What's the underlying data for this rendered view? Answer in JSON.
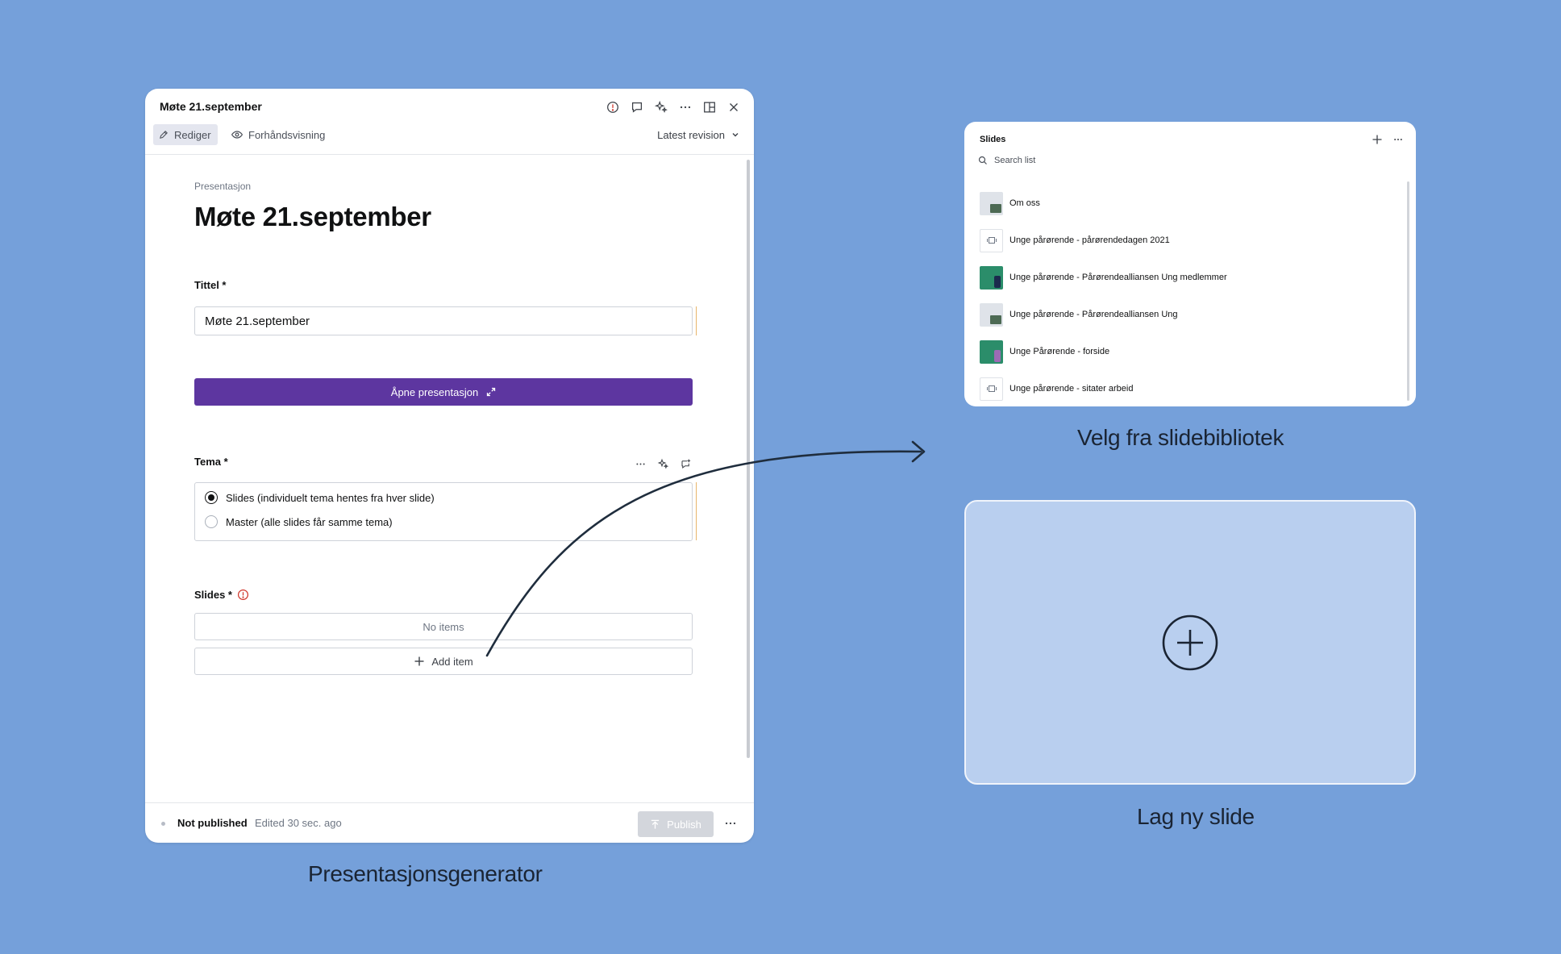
{
  "editor": {
    "window_title": "Møte 21.september",
    "tabs": {
      "edit": "Rediger",
      "preview": "Forhåndsvisning"
    },
    "revision": "Latest revision",
    "document_type": "Presentasjon",
    "document_title": "Møte 21.september",
    "fields": {
      "tittel": {
        "label": "Tittel *",
        "value": "Møte 21.september"
      },
      "open_button": "Åpne presentasjon",
      "tema": {
        "label": "Tema *",
        "options": [
          {
            "label": "Slides (individuelt tema hentes fra hver slide)",
            "selected": true
          },
          {
            "label": "Master (alle slides får samme tema)",
            "selected": false
          }
        ]
      },
      "slides": {
        "label": "Slides *",
        "empty_text": "No items",
        "add_label": "Add item"
      }
    },
    "footer": {
      "status": "Not published",
      "edited": "Edited 30 sec. ago",
      "publish_label": "Publish"
    },
    "colors": {
      "primary_button": "#5d36a0",
      "accent_bar": "#e8b56b",
      "warning": "#d0352a"
    }
  },
  "library": {
    "title": "Slides",
    "search_placeholder": "Search list",
    "items": [
      {
        "label": "Om oss",
        "thumb": "light-photo"
      },
      {
        "label": "Unge pårørende - pårørendedagen 2021",
        "thumb": "slide-icon"
      },
      {
        "label": "Unge pårørende - Pårørendealliansen Ung medlemmer",
        "thumb": "green-photo"
      },
      {
        "label": "Unge pårørende - Pårørendealliansen Ung",
        "thumb": "light-photo"
      },
      {
        "label": "Unge Pårørende - forside",
        "thumb": "green-person"
      },
      {
        "label": "Unge pårørende - sitater arbeid",
        "thumb": "slide-icon"
      }
    ]
  },
  "captions": {
    "editor": "Presentasjonsgenerator",
    "library": "Velg fra slidebibliotek",
    "new_slide": "Lag ny slide"
  },
  "background": "#75a0da"
}
